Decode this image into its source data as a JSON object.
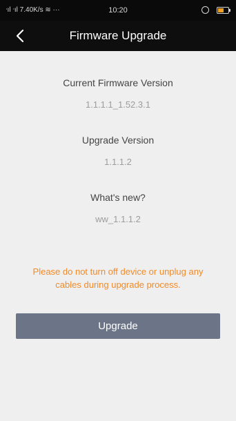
{
  "status_bar": {
    "network_text": "ᐧıl ᐧıl 7.40K/s ",
    "wifi_glyph": "≋",
    "more_text": " ···",
    "time": "10:20",
    "battery_level": 0.55,
    "battery_color": "#f0a020"
  },
  "app_bar": {
    "back_icon": "chevron-left-icon",
    "title": "Firmware Upgrade"
  },
  "info": {
    "current_label": "Current Firmware Version",
    "current_value": "1.1.1.1_1.52.3.1",
    "upgrade_label": "Upgrade Version",
    "upgrade_value": "1.1.1.2",
    "whats_new_label": "What's new?",
    "whats_new_value": "ww_1.1.1.2"
  },
  "warning_text": "Please do not turn off device or unplug any cables during upgrade process.",
  "upgrade_button_label": "Upgrade",
  "colors": {
    "warning": "#f08a2a",
    "button": "#6c7587",
    "header": "#0e0e0e",
    "background": "#efefef"
  }
}
